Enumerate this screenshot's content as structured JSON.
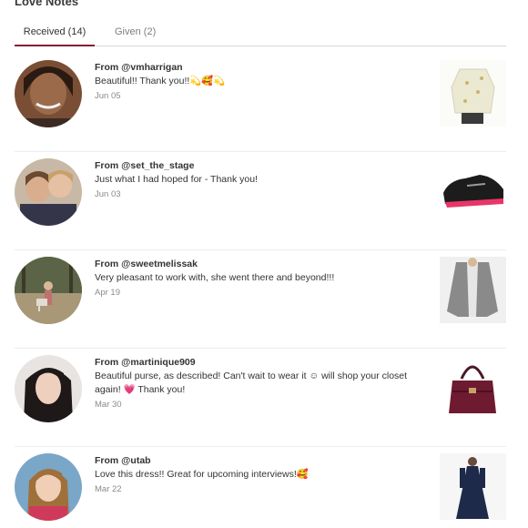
{
  "page": {
    "title": "Love Notes"
  },
  "tabs": [
    {
      "label": "Received (14)"
    },
    {
      "label": "Given (2)"
    }
  ],
  "notes": [
    {
      "from": "From @vmharrigan",
      "message": "Beautiful!! Thank you!!💫🥰💫",
      "date": "Jun 05",
      "product": "floral-blouse"
    },
    {
      "from": "From @set_the_stage",
      "message": "Just what I had hoped for - Thank you!",
      "date": "Jun 03",
      "product": "sneaker"
    },
    {
      "from": "From @sweetmelissak",
      "message": "Very pleasant to work with, she went there and beyond!!!",
      "date": "Apr 19",
      "product": "grey-cardigan"
    },
    {
      "from": "From @martinique909",
      "message": "Beautiful purse, as described! Can't wait to wear it ☺ will shop your closet again! 💗 Thank you!",
      "date": "Mar 30",
      "product": "purple-purse"
    },
    {
      "from": "From @utab",
      "message": "Love this dress!! Great for upcoming interviews!🥰",
      "date": "Mar 22",
      "product": "navy-dress"
    }
  ]
}
